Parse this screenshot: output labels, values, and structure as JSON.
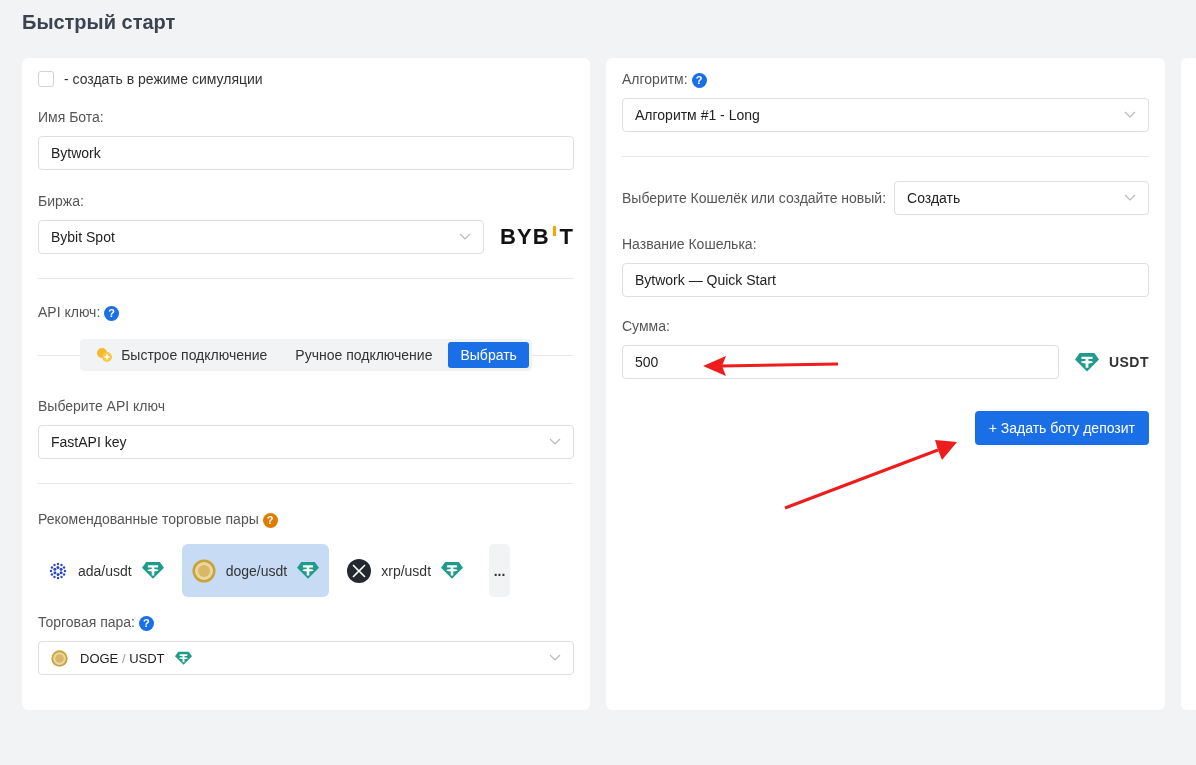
{
  "title": "Быстрый старт",
  "left_card": {
    "simulation": {
      "label": "- создать в режиме симуляции",
      "checked": false
    },
    "bot_name": {
      "label": "Имя Бота:",
      "value": "Bytwork"
    },
    "exchange": {
      "label": "Биржа:",
      "value": "Bybit Spot",
      "logo": {
        "left": "BYB",
        "right": "T"
      }
    },
    "api_key": {
      "label": "API ключ:",
      "help": "?"
    },
    "connection_tabs": [
      {
        "label": "Быстрое подключение",
        "kind": "icon",
        "selected": false
      },
      {
        "label": "Ручное подключение",
        "kind": "plain",
        "selected": false
      },
      {
        "label": "Выбрать",
        "kind": "plain",
        "selected": true
      }
    ],
    "api_select": {
      "label": "Выберите API ключ",
      "value": "FastAPI key"
    },
    "recommended": {
      "label": "Рекомендованные торговые пары",
      "help": "?",
      "pairs": [
        {
          "label": "ada/usdt",
          "kind": "ada",
          "selected": false
        },
        {
          "label": "doge/usdt",
          "kind": "doge",
          "selected": true
        },
        {
          "label": "xrp/usdt",
          "kind": "xrp",
          "selected": false
        }
      ],
      "more": "..."
    },
    "trading_pair": {
      "label": "Торговая пара:",
      "help": "?",
      "base": "DOGE",
      "separator": "/",
      "quote": "USDT"
    }
  },
  "right_card": {
    "algorithm": {
      "label": "Алгоритм:",
      "help": "?",
      "value": "Алгоритм #1 - Long"
    },
    "wallet": {
      "label": "Выберите Кошелёк или создайте новый:",
      "value": "Создать"
    },
    "wallet_name": {
      "label": "Название Кошелька:",
      "value": "Bytwork — Quick Start"
    },
    "amount": {
      "label": "Сумма:",
      "value": "500",
      "currency": "USDT"
    },
    "deposit_button": "+ Задать боту депозит"
  }
}
